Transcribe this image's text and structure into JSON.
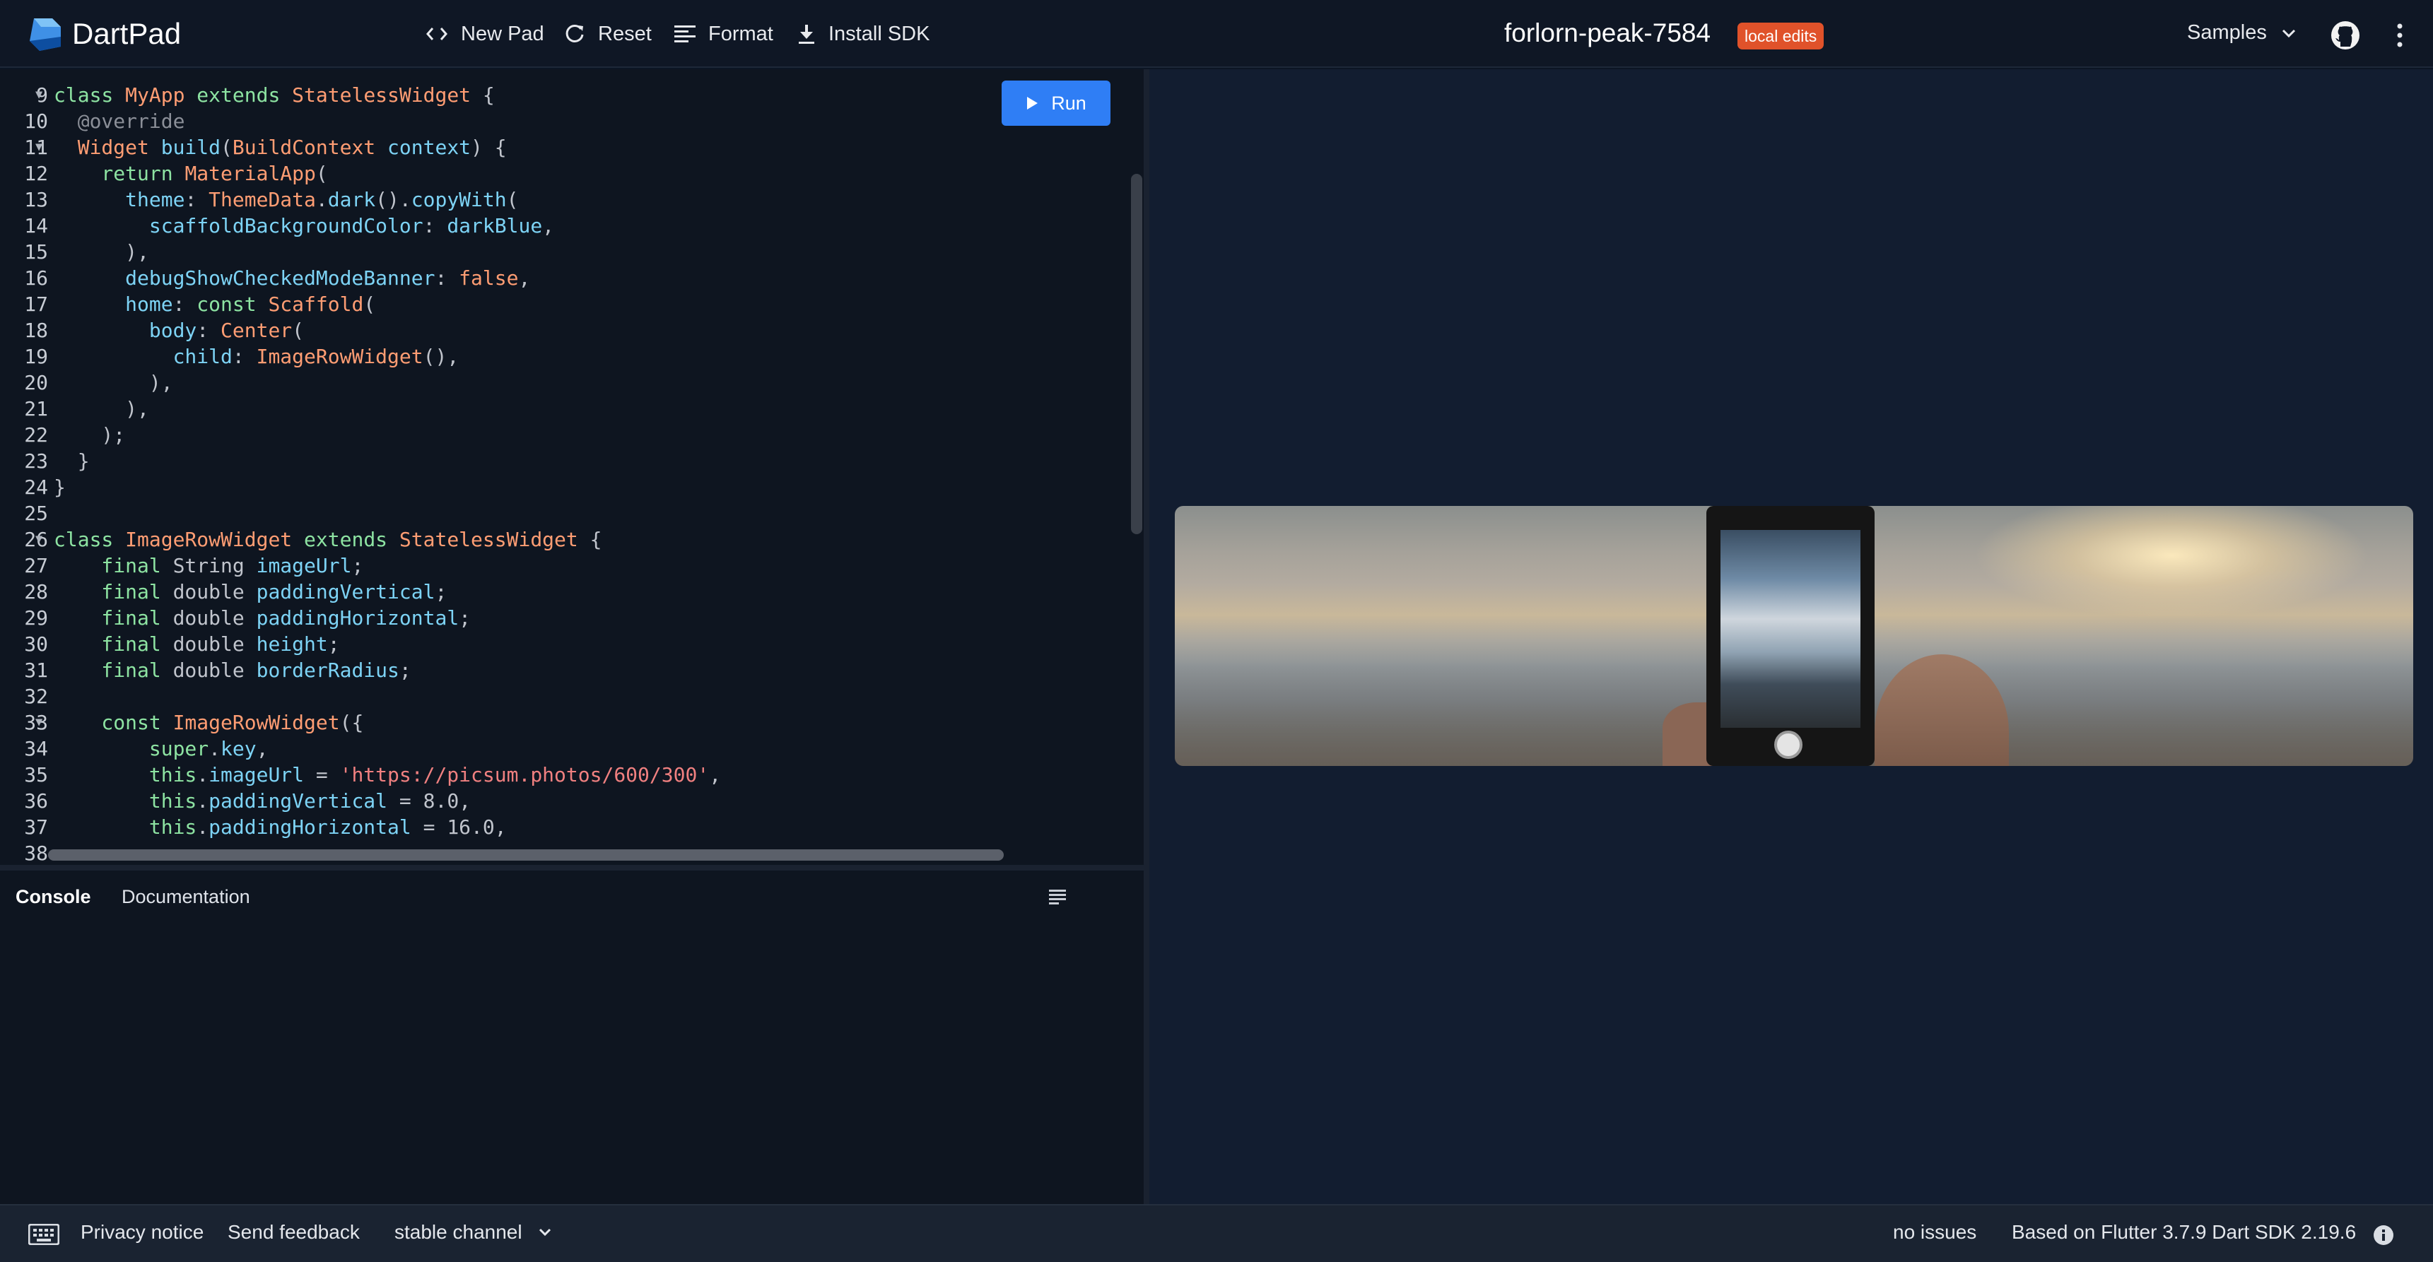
{
  "app": {
    "title": "DartPad",
    "pad_name": "forlorn-peak-7584",
    "badge": "local edits"
  },
  "toolbar": {
    "new_pad": "New Pad",
    "reset": "Reset",
    "format": "Format",
    "install_sdk": "Install SDK",
    "samples": "Samples"
  },
  "editor": {
    "run_label": "Run",
    "lines": [
      {
        "n": "9",
        "fold": true
      },
      {
        "n": "10"
      },
      {
        "n": "11",
        "fold": true
      },
      {
        "n": "12"
      },
      {
        "n": "13"
      },
      {
        "n": "14"
      },
      {
        "n": "15"
      },
      {
        "n": "16"
      },
      {
        "n": "17"
      },
      {
        "n": "18"
      },
      {
        "n": "19"
      },
      {
        "n": "20"
      },
      {
        "n": "21"
      },
      {
        "n": "22"
      },
      {
        "n": "23"
      },
      {
        "n": "24"
      },
      {
        "n": "25"
      },
      {
        "n": "26",
        "fold": true
      },
      {
        "n": "27"
      },
      {
        "n": "28"
      },
      {
        "n": "29"
      },
      {
        "n": "30"
      },
      {
        "n": "31"
      },
      {
        "n": "32"
      },
      {
        "n": "33",
        "fold": true
      },
      {
        "n": "34"
      },
      {
        "n": "35"
      },
      {
        "n": "36"
      },
      {
        "n": "37"
      },
      {
        "n": "38"
      }
    ],
    "code": [
      [
        [
          "kw",
          "class "
        ],
        [
          "ty",
          "MyApp"
        ],
        [
          "kw",
          " extends "
        ],
        [
          "ty",
          "StatelessWidget"
        ],
        [
          "nm",
          " {"
        ]
      ],
      [
        [
          "an",
          "  @override"
        ]
      ],
      [
        [
          "ty",
          "  Widget"
        ],
        [
          "id",
          " build"
        ],
        [
          "nm",
          "("
        ],
        [
          "ty",
          "BuildContext"
        ],
        [
          "id",
          " context"
        ],
        [
          "nm",
          ") {"
        ]
      ],
      [
        [
          "kw",
          "    return "
        ],
        [
          "ty",
          "MaterialApp"
        ],
        [
          "nm",
          "("
        ]
      ],
      [
        [
          "id",
          "      theme"
        ],
        [
          "nm",
          ": "
        ],
        [
          "ty",
          "ThemeData"
        ],
        [
          "nm",
          "."
        ],
        [
          "id",
          "dark"
        ],
        [
          "nm",
          "()."
        ],
        [
          "id",
          "copyWith"
        ],
        [
          "nm",
          "("
        ]
      ],
      [
        [
          "id",
          "        scaffoldBackgroundColor"
        ],
        [
          "nm",
          ": "
        ],
        [
          "id",
          "darkBlue"
        ],
        [
          "nm",
          ","
        ]
      ],
      [
        [
          "nm",
          "      ),"
        ]
      ],
      [
        [
          "id",
          "      debugShowCheckedModeBanner"
        ],
        [
          "nm",
          ": "
        ],
        [
          "ty",
          "false"
        ],
        [
          "nm",
          ","
        ]
      ],
      [
        [
          "id",
          "      home"
        ],
        [
          "nm",
          ": "
        ],
        [
          "kw",
          "const "
        ],
        [
          "ty",
          "Scaffold"
        ],
        [
          "nm",
          "("
        ]
      ],
      [
        [
          "id",
          "        body"
        ],
        [
          "nm",
          ": "
        ],
        [
          "ty",
          "Center"
        ],
        [
          "nm",
          "("
        ]
      ],
      [
        [
          "id",
          "          child"
        ],
        [
          "nm",
          ": "
        ],
        [
          "ty",
          "ImageRowWidget"
        ],
        [
          "nm",
          "(),"
        ]
      ],
      [
        [
          "nm",
          "        ),"
        ]
      ],
      [
        [
          "nm",
          "      ),"
        ]
      ],
      [
        [
          "nm",
          "    );"
        ]
      ],
      [
        [
          "nm",
          "  }"
        ]
      ],
      [
        [
          "nm",
          "}"
        ]
      ],
      [
        [
          "nm",
          ""
        ]
      ],
      [
        [
          "kw",
          "class "
        ],
        [
          "ty",
          "ImageRowWidget"
        ],
        [
          "kw",
          " extends "
        ],
        [
          "ty",
          "StatelessWidget"
        ],
        [
          "nm",
          " {"
        ]
      ],
      [
        [
          "kw",
          "    final "
        ],
        [
          "nm",
          "String "
        ],
        [
          "id",
          "imageUrl"
        ],
        [
          "nm",
          ";"
        ]
      ],
      [
        [
          "kw",
          "    final "
        ],
        [
          "nm",
          "double "
        ],
        [
          "id",
          "paddingVertical"
        ],
        [
          "nm",
          ";"
        ]
      ],
      [
        [
          "kw",
          "    final "
        ],
        [
          "nm",
          "double "
        ],
        [
          "id",
          "paddingHorizontal"
        ],
        [
          "nm",
          ";"
        ]
      ],
      [
        [
          "kw",
          "    final "
        ],
        [
          "nm",
          "double "
        ],
        [
          "id",
          "height"
        ],
        [
          "nm",
          ";"
        ]
      ],
      [
        [
          "kw",
          "    final "
        ],
        [
          "nm",
          "double "
        ],
        [
          "id",
          "borderRadius"
        ],
        [
          "nm",
          ";"
        ]
      ],
      [
        [
          "nm",
          ""
        ]
      ],
      [
        [
          "kw",
          "    const "
        ],
        [
          "ty",
          "ImageRowWidget"
        ],
        [
          "nm",
          "({"
        ]
      ],
      [
        [
          "kw",
          "        super"
        ],
        [
          "nm",
          "."
        ],
        [
          "id",
          "key"
        ],
        [
          "nm",
          ","
        ]
      ],
      [
        [
          "kw",
          "        this"
        ],
        [
          "nm",
          "."
        ],
        [
          "id",
          "imageUrl"
        ],
        [
          "nm",
          " = "
        ],
        [
          "str",
          "'https://picsum.photos/600/300'"
        ],
        [
          "nm",
          ","
        ]
      ],
      [
        [
          "kw",
          "        this"
        ],
        [
          "nm",
          "."
        ],
        [
          "id",
          "paddingVertical"
        ],
        [
          "nm",
          " = "
        ],
        [
          "nm",
          "8.0"
        ],
        [
          "nm",
          ","
        ]
      ],
      [
        [
          "kw",
          "        this"
        ],
        [
          "nm",
          "."
        ],
        [
          "id",
          "paddingHorizontal"
        ],
        [
          "nm",
          " = "
        ],
        [
          "nm",
          "16.0"
        ],
        [
          "nm",
          ","
        ]
      ],
      [
        [
          "nm",
          ""
        ]
      ]
    ]
  },
  "console": {
    "tabs": [
      "Console",
      "Documentation"
    ]
  },
  "footer": {
    "privacy": "Privacy notice",
    "feedback": "Send feedback",
    "channel": "stable channel",
    "status": "no issues",
    "version": "Based on Flutter 3.7.9 Dart SDK 2.19.6"
  },
  "colors": {
    "accent": "#2f7ef5",
    "badge": "#e0522a",
    "keyword": "#8de3a2",
    "type": "#ff9d73",
    "identifier": "#7dd3f5",
    "string": "#f08080"
  },
  "icons": [
    "dartpad-logo-icon",
    "code-icon",
    "refresh-icon",
    "format-icon",
    "download-icon",
    "chevron-down-icon",
    "github-icon",
    "more-vert-icon",
    "play-icon",
    "clear-console-icon",
    "keyboard-icon",
    "info-icon"
  ]
}
